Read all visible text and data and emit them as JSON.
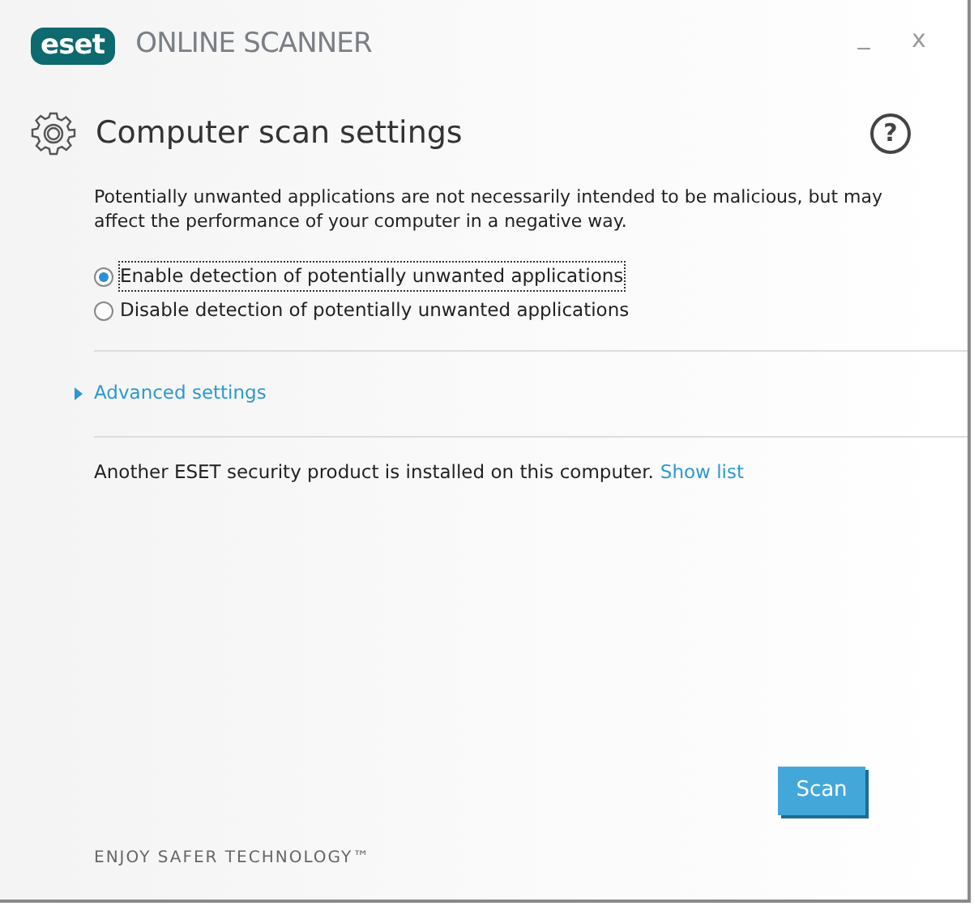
{
  "window": {
    "logo": "eset",
    "title": "ONLINE SCANNER",
    "minimize": "_",
    "close": "x"
  },
  "heading": {
    "title": "Computer scan settings",
    "help": "?"
  },
  "description": "Potentially unwanted applications are not necessarily intended to be malicious, but may affect the performance of your computer in a negative way.",
  "options": [
    {
      "label": "Enable detection of potentially unwanted applications",
      "selected": true
    },
    {
      "label": "Disable detection of potentially unwanted applications",
      "selected": false
    }
  ],
  "advanced": {
    "label": "Advanced settings",
    "expanded": false
  },
  "notice": {
    "text": "Another ESET security product is installed on this computer.",
    "link": "Show list"
  },
  "scan_button": "Scan",
  "footer": "ENJOY SAFER TECHNOLOGY™"
}
